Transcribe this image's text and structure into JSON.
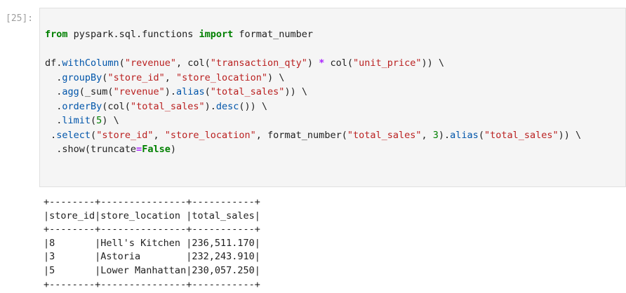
{
  "cell": {
    "prompt": "[25]:"
  },
  "code": {
    "line1": {
      "kw_from": "from",
      "module": " pyspark.sql.functions ",
      "kw_import": "import",
      "name": " format_number"
    },
    "line3": {
      "p1": "df.",
      "m1": "withColumn",
      "p2": "(",
      "s1": "\"revenue\"",
      "p3": ", col(",
      "s2": "\"transaction_qty\"",
      "p4": ") ",
      "op": "*",
      "p5": " col(",
      "s3": "\"unit_price\"",
      "p6": ")) \\"
    },
    "line4": {
      "p1": "  .",
      "m1": "groupBy",
      "p2": "(",
      "s1": "\"store_id\"",
      "p3": ", ",
      "s2": "\"store_location\"",
      "p4": ") \\"
    },
    "line5": {
      "p1": "  .",
      "m1": "agg",
      "p2": "(_sum(",
      "s1": "\"revenue\"",
      "p3": ").",
      "m2": "alias",
      "p4": "(",
      "s2": "\"total_sales\"",
      "p5": ")) \\"
    },
    "line6": {
      "p1": "  .",
      "m1": "orderBy",
      "p2": "(col(",
      "s1": "\"total_sales\"",
      "p3": ").",
      "m2": "desc",
      "p4": "()) \\"
    },
    "line7": {
      "p1": "  .",
      "m1": "limit",
      "p2": "(",
      "n1": "5",
      "p3": ") \\"
    },
    "line8": {
      "p1": " .",
      "m1": "select",
      "p2": "(",
      "s1": "\"store_id\"",
      "p3": ", ",
      "s2": "\"store_location\"",
      "p4": ", format_number(",
      "s3": "\"total_sales\"",
      "p5": ", ",
      "n1": "3",
      "p6": ").",
      "m2": "alias",
      "p7": "(",
      "s4": "\"total_sales\"",
      "p8": ")) \\"
    },
    "line9": {
      "p1": "  .show(truncate",
      "op": "=",
      "kw": "False",
      "p2": ")"
    }
  },
  "output": {
    "lines": [
      "+--------+---------------+-----------+",
      "|store_id|store_location |total_sales|",
      "+--------+---------------+-----------+",
      "|8       |Hell's Kitchen |236,511.170|",
      "|3       |Astoria        |232,243.910|",
      "|5       |Lower Manhattan|230,057.250|",
      "+--------+---------------+-----------+"
    ]
  }
}
